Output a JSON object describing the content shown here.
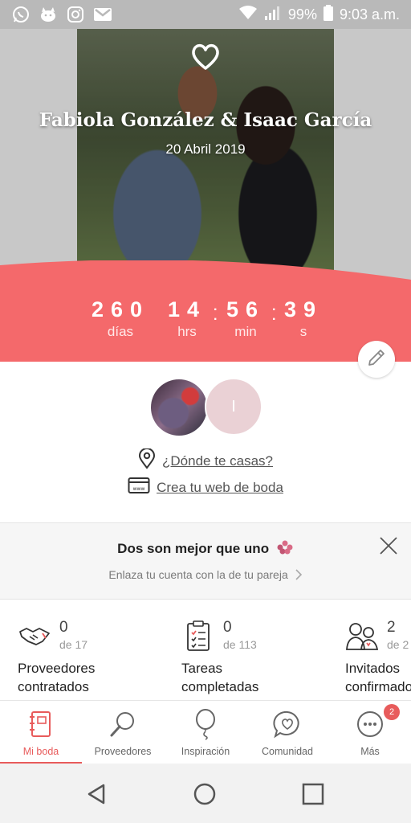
{
  "status_bar": {
    "battery": "99%",
    "time": "9:03 a.m.",
    "icons": [
      "whatsapp-icon",
      "cat-app-icon",
      "instagram-icon",
      "gmail-icon",
      "wifi-icon",
      "signal-icon",
      "battery-icon"
    ]
  },
  "hero": {
    "couple_names": "Fabiola González & Isaac García",
    "wedding_date": "20 Abril 2019",
    "accent_color": "#f4696b"
  },
  "countdown": {
    "days": "260",
    "days_label": "días",
    "hours": "14",
    "hours_label": "hrs",
    "minutes": "56",
    "minutes_label": "min",
    "seconds": "39",
    "seconds_label": "s"
  },
  "profile": {
    "partner_initial": "I",
    "location_link": "¿Dónde te casas?",
    "website_link": "Crea tu web de boda"
  },
  "partner_card": {
    "title": "Dos son mejor que uno",
    "subtitle": "Enlaza tu cuenta con la de tu pareja"
  },
  "stats": [
    {
      "value": "0",
      "of": "de 17",
      "label_line1": "Proveedores",
      "label_line2": "contratados",
      "icon": "handshake-icon"
    },
    {
      "value": "0",
      "of": "de 113",
      "label_line1": "Tareas",
      "label_line2": "completadas",
      "icon": "checklist-icon"
    },
    {
      "value": "2",
      "of": "de 2",
      "label_line1": "Invitados",
      "label_line2": "confirmados",
      "icon": "guests-icon"
    }
  ],
  "tabs": [
    {
      "label": "Mi boda",
      "icon": "notebook-icon",
      "active": true
    },
    {
      "label": "Proveedores",
      "icon": "magnifier-icon"
    },
    {
      "label": "Inspiración",
      "icon": "balloon-icon"
    },
    {
      "label": "Comunidad",
      "icon": "chat-heart-icon"
    },
    {
      "label": "Más",
      "icon": "more-icon",
      "badge": "2"
    }
  ]
}
